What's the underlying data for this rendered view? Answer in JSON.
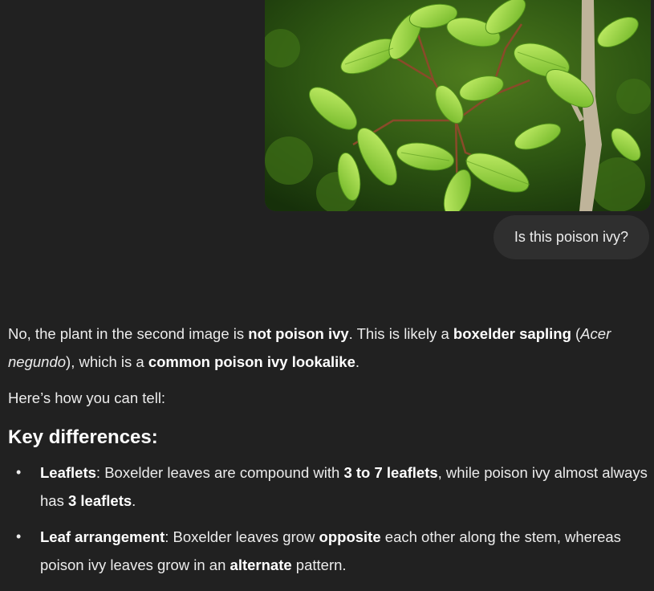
{
  "conversation": {
    "user_image": {
      "alt": "Photo of a green leafy sapling with compound leaves"
    },
    "user_message": "Is this poison ivy?",
    "assistant": {
      "p1": {
        "t1": "No, the plant in the second image is ",
        "b1": "not poison ivy",
        "t2": ". This is likely a ",
        "b2": "boxelder sapling",
        "t3": " (",
        "i1": "Acer negundo",
        "t4": "), which is a ",
        "b3": "common poison ivy lookalike",
        "t5": "."
      },
      "p2": "Here’s how you can tell:",
      "heading": "Key differences:",
      "bullets": [
        {
          "bullet": "•",
          "label": "Leaflets",
          "t1": ": Boxelder leaves are compound with ",
          "b1": "3 to 7 leaflets",
          "t2": ", while poison ivy almost always has ",
          "b2": "3 leaflets",
          "t3": "."
        },
        {
          "bullet": "•",
          "label": "Leaf arrangement",
          "t1": ": Boxelder leaves grow ",
          "b1": "opposite",
          "t2": " each other along the stem, whereas poison ivy leaves grow in an ",
          "b2": "alternate",
          "t3": " pattern."
        }
      ]
    }
  },
  "colors": {
    "background": "#212121",
    "user_bubble": "#2f2f2f",
    "text": "#ececec",
    "leaf_green": "#8fd43a"
  }
}
